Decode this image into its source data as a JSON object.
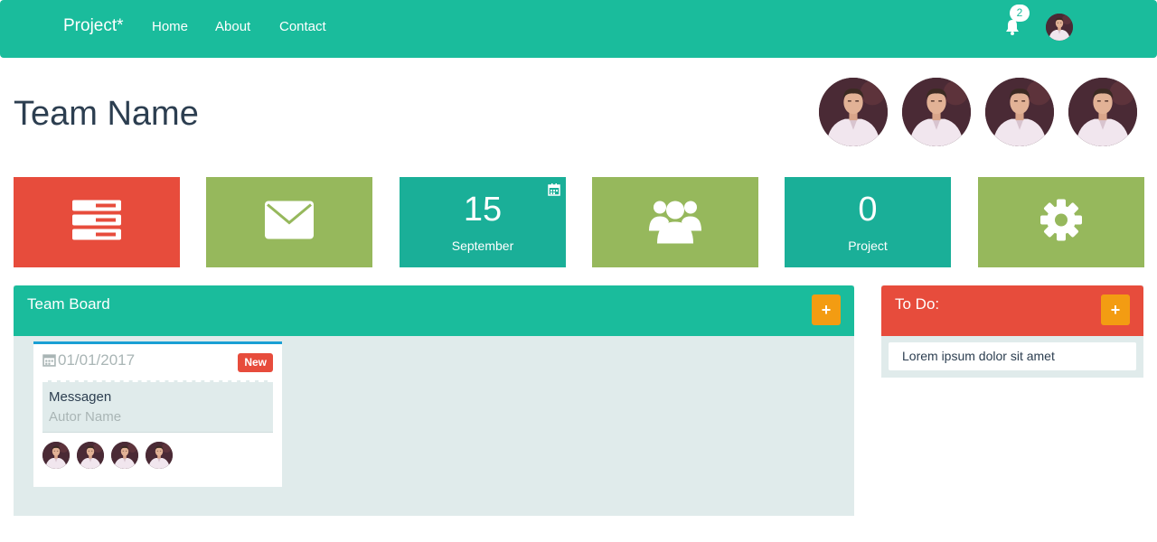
{
  "navbar": {
    "brand": "Project*",
    "links": [
      "Home",
      "About",
      "Contact"
    ],
    "notification_count": "2",
    "bell_icon": "bell-icon",
    "user_avatar": "user-avatar"
  },
  "header": {
    "title": "Team Name",
    "members": [
      "member-avatar",
      "member-avatar",
      "member-avatar",
      "member-avatar"
    ]
  },
  "tiles": [
    {
      "icon": "server-icon",
      "color": "#e74c3c"
    },
    {
      "icon": "envelope-icon",
      "color": "#96b85c"
    },
    {
      "big": "15",
      "small": "September",
      "icon": "calendar-icon",
      "color": "#1aaf98"
    },
    {
      "icon": "users-icon",
      "color": "#96b85c"
    },
    {
      "big": "0",
      "small": "Project",
      "color": "#1aaf98"
    },
    {
      "icon": "gear-icon",
      "color": "#96b85c"
    }
  ],
  "board": {
    "title": "Team Board",
    "add_icon": "plus-icon",
    "card": {
      "date": "01/01/2017",
      "badge": "New",
      "message": "Messagen",
      "author": "Autor Name",
      "avatars": [
        "avatar",
        "avatar",
        "avatar",
        "avatar"
      ]
    }
  },
  "todo": {
    "title": "To Do:",
    "add_icon": "plus-icon",
    "items": [
      "Lorem ipsum dolor sit amet"
    ]
  },
  "colors": {
    "primary": "#1abc9c",
    "danger": "#e74c3c",
    "accent_green": "#96b85c",
    "teal": "#1aaf98",
    "warning": "#f39c12",
    "panel_bg": "#e0ebeb"
  }
}
